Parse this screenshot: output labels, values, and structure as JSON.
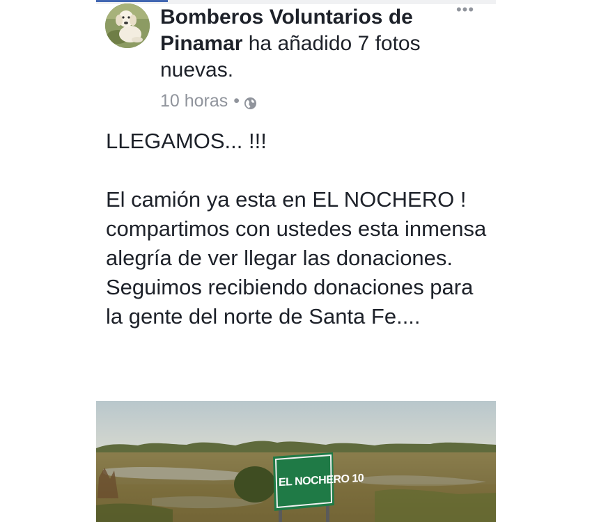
{
  "post": {
    "author": "Bomberos Voluntarios de Pinamar",
    "action": "ha añadido 7 fotos nuevas.",
    "timestamp": "10 horas",
    "separator": "•",
    "privacy_icon": "globe-icon",
    "more_label": "•••",
    "message": {
      "line1": "LLEGAMOS... !!!",
      "paragraph1": "El camión ya esta en EL NOCHERO ! compartimos con ustedes esta inmensa alegría de ver llegar las donaciones.",
      "paragraph2": "Seguimos recibiendo donaciones para la gente del norte de Santa Fe...."
    },
    "photo": {
      "sign_text": "EL NOCHERO 10"
    }
  },
  "colors": {
    "brand_blue": "#4267b2",
    "text": "#1d2129",
    "meta": "#90949c"
  }
}
